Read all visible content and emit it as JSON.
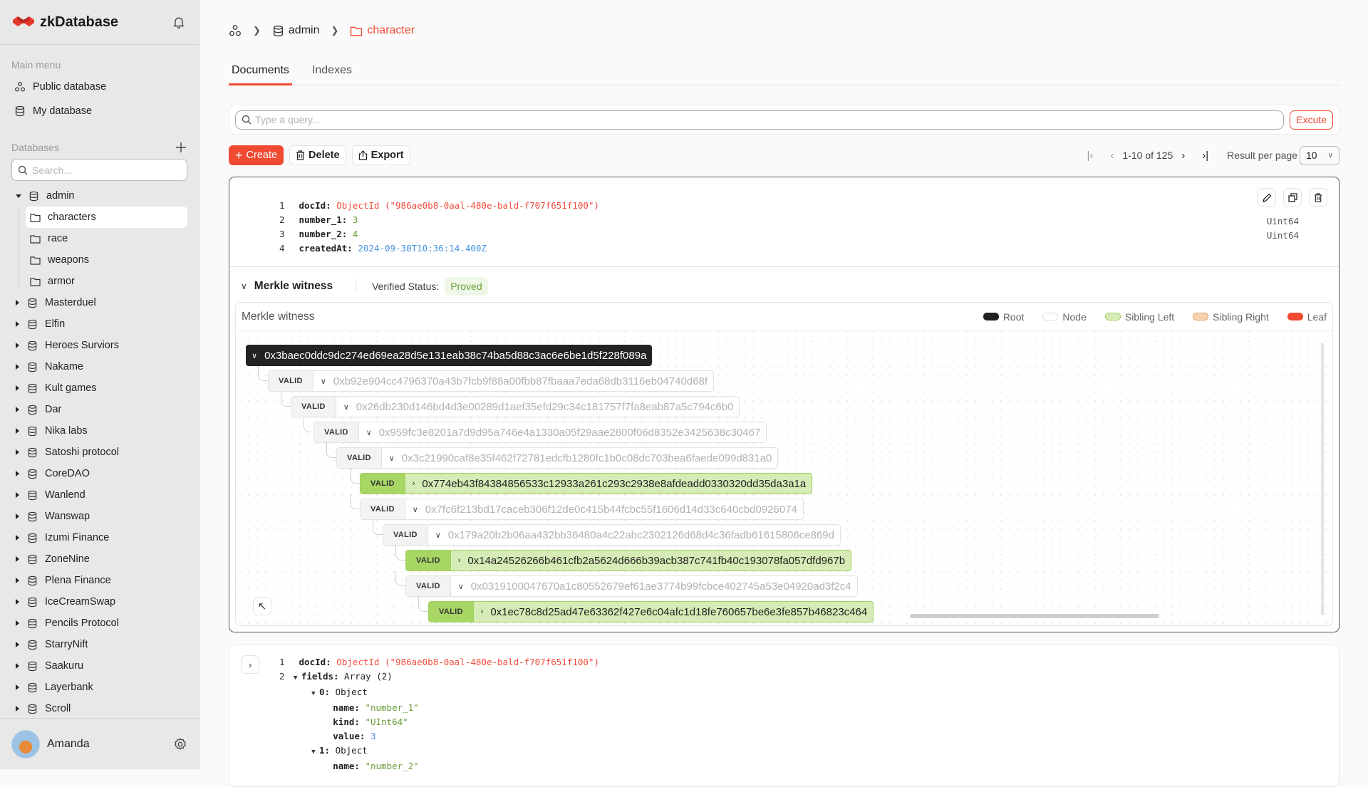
{
  "app": {
    "name": "zkDatabase"
  },
  "sidebar": {
    "main_menu_label": "Main menu",
    "menu": [
      {
        "label": "Public database",
        "icon": "public-database-icon"
      },
      {
        "label": "My database",
        "icon": "database-icon"
      }
    ],
    "databases_label": "Databases",
    "search_placeholder": "Search...",
    "expanded_db": {
      "name": "admin",
      "collections": [
        "characters",
        "race",
        "weapons",
        "armor"
      ],
      "active_collection": "characters"
    },
    "databases": [
      "Masterduel",
      "Elfin",
      "Heroes Surviors",
      "Nakame",
      "Kult games",
      "Dar",
      "Nika labs",
      "Satoshi protocol",
      "CoreDAO",
      "Wanlend",
      "Wanswap",
      "Izumi Finance",
      "ZoneNine",
      "Plena Finance",
      "IceCreamSwap",
      "Pencils Protocol",
      "StarryNift",
      "Saakuru",
      "Layerbank",
      "Scroll"
    ],
    "user": {
      "name": "Amanda"
    }
  },
  "breadcrumb": {
    "db": "admin",
    "collection": "character"
  },
  "tabs": [
    {
      "label": "Documents",
      "active": true
    },
    {
      "label": "Indexes",
      "active": false
    }
  ],
  "query": {
    "placeholder": "Type a query...",
    "execute_label": "Excute"
  },
  "toolbar": {
    "create": "Create",
    "delete": "Delete",
    "export": "Export"
  },
  "pagination": {
    "range": "1-10 of 125",
    "per_page_label": "Result per page",
    "per_page": "10"
  },
  "colors": {
    "accent": "#f04a33",
    "root": "#222222",
    "sibling_left": "#d6ecb6",
    "sibling_right": "#f5d3b0",
    "leaf": "#f04a33"
  },
  "doc1": {
    "lines": [
      {
        "n": "1",
        "key": "docId:",
        "type": "ObjectId",
        "value": " (\"986ae0b8-0aal-480e-bald-f707f651f100\")"
      },
      {
        "n": "2",
        "key": "number_1:",
        "value": "3"
      },
      {
        "n": "3",
        "key": "number_2:",
        "value": "4"
      },
      {
        "n": "4",
        "key": "createdAt:",
        "value": "2024-09-30T10:36:14.400Z"
      }
    ],
    "types": [
      "Uint64",
      "Uint64"
    ],
    "merkle": {
      "title": "Merkle witness",
      "verified_label": "Verified Status:",
      "status": "Proved",
      "panel_title": "Merkle witness",
      "legend": [
        "Root",
        "Node",
        "Sibling Left",
        "Sibling Right",
        "Leaf"
      ],
      "root": "0x3baec0ddc9dc274ed69ea28d5e131eab38c74ba5d88c3ac6e6be1d5f228f089a",
      "nodes": [
        {
          "status": "VALID",
          "hash": "0xb92e904cc4796370a43b7fcb9f88a00fbb87fbaaa7eda68db3116eb04740d68f",
          "kind": "node"
        },
        {
          "status": "VALID",
          "hash": "0x26db230d146bd4d3e00289d1aef35efd29c34c181757f7fa8eab87a5c794c6b0",
          "kind": "node"
        },
        {
          "status": "VALID",
          "hash": "0x959fc3e8201a7d9d95a746e4a1330a05f29aae2800f06d8352e3425638c30467",
          "kind": "node"
        },
        {
          "status": "VALID",
          "hash": "0x3c21990caf8e35f462f72781edcfb1280fc1b0c08dc703bea6faede099d831a0",
          "kind": "node"
        },
        {
          "status": "VALID",
          "hash": "0x774eb43f84384856533c12933a261c293c2938e8afdeadd0330320dd35da3a1a",
          "kind": "sibling-left"
        },
        {
          "status": "VALID",
          "hash": "0x7fc6f213bd17caceb306f12de0c415b44fcbc55f1606d14d33c640cbd0926074",
          "kind": "node"
        },
        {
          "status": "VALID",
          "hash": "0x179a20b2b06aa432bb36480a4c22abc2302126d68d4c36fadb61615806ce869d",
          "kind": "node"
        },
        {
          "status": "VALID",
          "hash": "0x14a24526266b461cfb2a5624d666b39acb387c741fb40c193078fa057dfd967b",
          "kind": "sibling-left"
        },
        {
          "status": "VALID",
          "hash": "0x0319100047670a1c80552679ef61ae3774b99fcbce402745a53e04920ad3f2c4",
          "kind": "node"
        },
        {
          "status": "VALID",
          "hash": "0x1ec78c8d25ad47e63362f427e6c04afc1d18fe760657be6e3fe857b46823c464",
          "kind": "sibling-left"
        }
      ]
    }
  },
  "doc2": {
    "l1": {
      "n": "1",
      "key": "docId:",
      "type": "ObjectId",
      "value": " (\"986ae0b8-0aal-480e-bald-f707f651f100\")"
    },
    "l2": {
      "n": "2",
      "key": "fields:",
      "value": " Array (2)"
    },
    "obj0": {
      "key": "0:",
      "value": " Object",
      "name": "\"number_1\"",
      "kind": "\"UInt64\"",
      "val": "3"
    },
    "obj1": {
      "key": "1:",
      "value": " Object",
      "name": "\"number_2\""
    },
    "keys": {
      "name": "name:",
      "kind": "kind:",
      "value": "value:"
    }
  }
}
